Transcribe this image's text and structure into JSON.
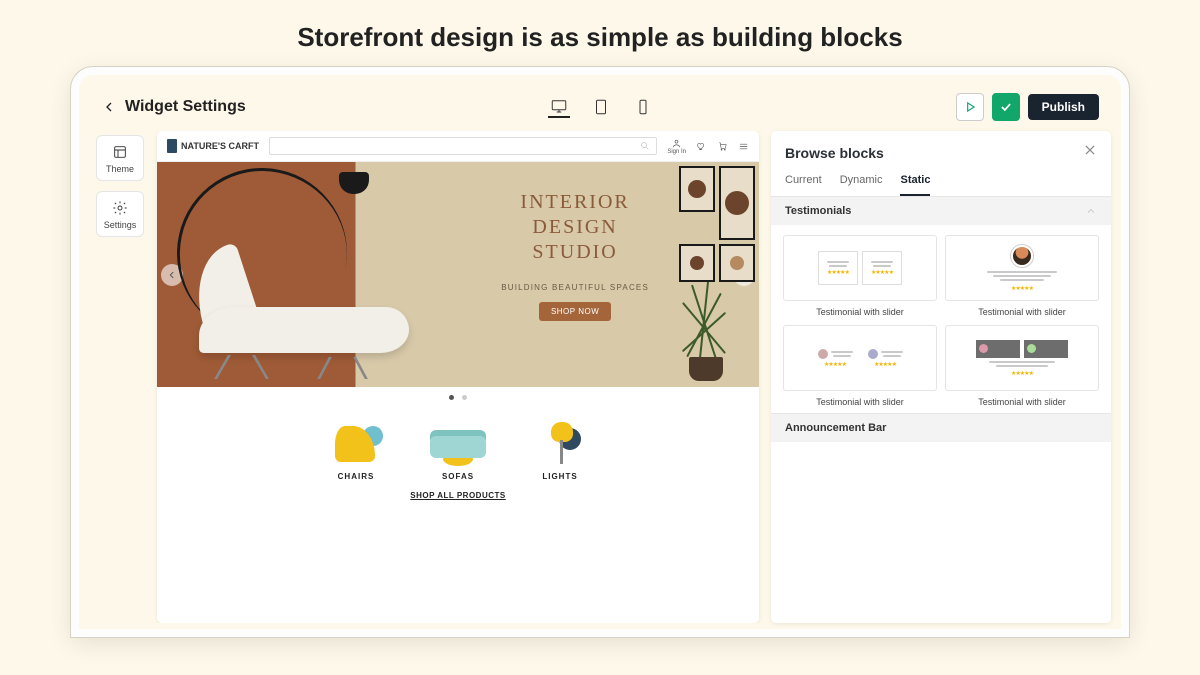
{
  "headline": "Storefront design is as simple as building blocks",
  "topbar": {
    "title": "Widget Settings",
    "publish": "Publish"
  },
  "tools": {
    "theme": "Theme",
    "settings": "Settings"
  },
  "store": {
    "brand": "NATURE'S CARFT",
    "user_label": "Sign In",
    "hero": {
      "title_line1": "INTERIOR",
      "title_line2": "DESIGN",
      "title_line3": "STUDIO",
      "subtitle": "BUILDING BEAUTIFUL SPACES",
      "cta": "SHOP NOW"
    },
    "categories": [
      {
        "label": "CHAIRS"
      },
      {
        "label": "SOFAS"
      },
      {
        "label": "LIGHTS"
      }
    ],
    "shop_all": "SHOP ALL PRODUCTS"
  },
  "panel": {
    "title": "Browse blocks",
    "tabs": {
      "current": "Current",
      "dynamic": "Dynamic",
      "static": "Static"
    },
    "section_testimonials": "Testimonials",
    "section_announcement": "Announcement Bar",
    "block_label": "Testimonial with slider"
  }
}
